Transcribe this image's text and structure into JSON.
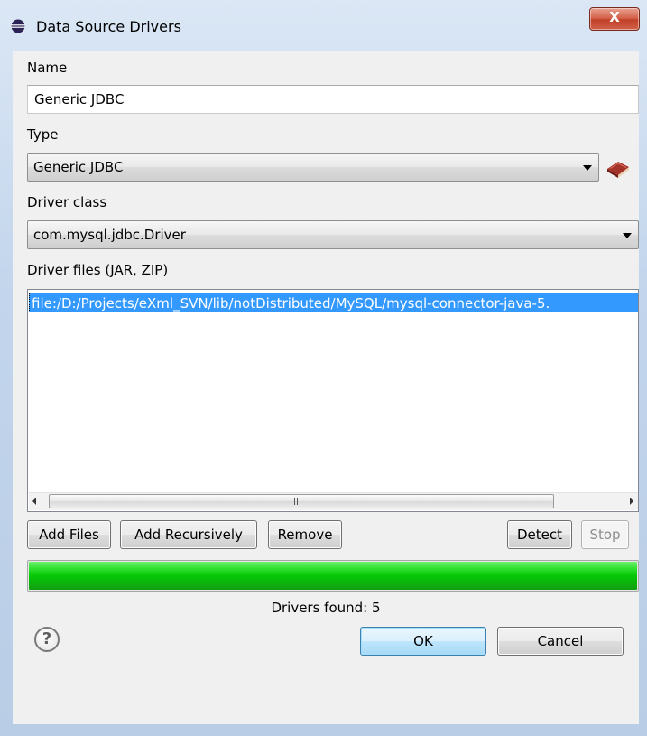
{
  "window": {
    "title": "Data Source Drivers",
    "close_glyph": "X"
  },
  "form": {
    "name_label": "Name",
    "name_value": "Generic JDBC",
    "type_label": "Type",
    "type_value": "Generic JDBC",
    "driver_class_label": "Driver class",
    "driver_class_value": "com.mysql.jdbc.Driver",
    "driver_files_label": "Driver files (JAR, ZIP)",
    "driver_files": [
      "file:/D:/Projects/eXml_SVN/lib/notDistributed/MySQL/mysql-connector-java-5."
    ],
    "scroll_grip": "III"
  },
  "buttons": {
    "add_files": "Add Files",
    "add_recursively": "Add Recursively",
    "remove": "Remove",
    "detect": "Detect",
    "stop": "Stop",
    "ok": "OK",
    "cancel": "Cancel"
  },
  "progress": {
    "value": 1.0,
    "color": "#06c706"
  },
  "status": {
    "drivers_found": "Drivers found: 5"
  },
  "help": {
    "glyph": "?"
  },
  "icons": {
    "title_icon": "eclipse-icon",
    "type_help": "book-icon",
    "help": "help-icon"
  }
}
